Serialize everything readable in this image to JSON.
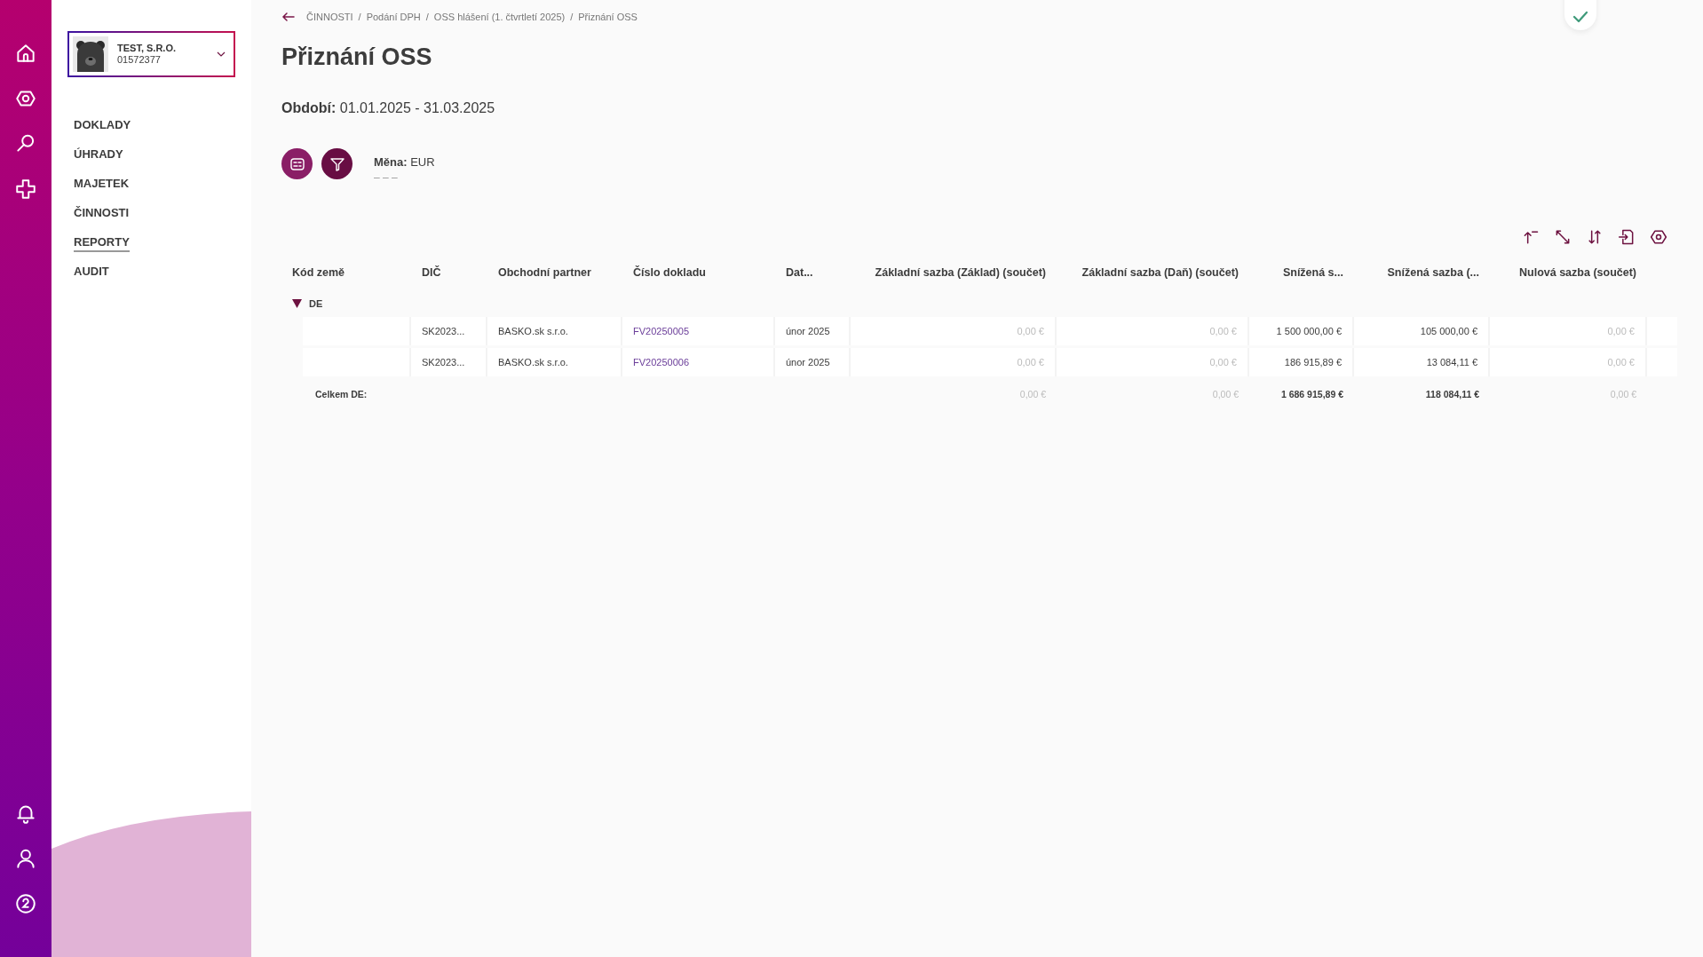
{
  "company": {
    "name": "TEST, S.R.O.",
    "id": "01572377"
  },
  "nav": [
    {
      "label": "DOKLADY",
      "selected": false
    },
    {
      "label": "ÚHRADY",
      "selected": false
    },
    {
      "label": "MAJETEK",
      "selected": false
    },
    {
      "label": "ČINNOSTI",
      "selected": false
    },
    {
      "label": "REPORTY",
      "selected": true
    },
    {
      "label": "AUDIT",
      "selected": false
    }
  ],
  "breadcrumb": {
    "separator": "/",
    "items": [
      "ČINNOSTI",
      "Podání DPH",
      "OSS hlášení (1. čtvrtletí 2025)",
      "Přiznání OSS"
    ]
  },
  "title": "Přiznání OSS",
  "period": "**Období:** 01.01.2025 - 31.03.2025",
  "currency": "**Měna:** EUR",
  "currency_hint": "– – –",
  "table": {
    "columns": [
      "Kód země",
      "DIČ",
      "Obchodní partner",
      "Číslo dokladu",
      "Dat...",
      "Základní sazba (Základ) (součet)",
      "Základní sazba (Daň) (součet)",
      "Snížená s...",
      "Snížená sazba (...",
      "Nulová sazba (součet)"
    ],
    "groups": [
      {
        "label": "DE",
        "expanded": true,
        "rows": [
          {
            "dic": "SK2023...",
            "partner": "BASKO.sk s.r.o.",
            "document": "FV20250005",
            "date": "únor 2025",
            "amounts": [
              {
                "value": "0,00 €",
                "dimmed": true
              },
              {
                "value": "0,00 €",
                "dimmed": true
              },
              {
                "value": "1 500 000,00 €",
                "dimmed": false
              },
              {
                "value": "105 000,00 €",
                "dimmed": false
              },
              {
                "value": "0,00 €",
                "dimmed": true
              }
            ]
          },
          {
            "dic": "SK2023...",
            "partner": "BASKO.sk s.r.o.",
            "document": "FV20250006",
            "date": "únor 2025",
            "amounts": [
              {
                "value": "0,00 €",
                "dimmed": true
              },
              {
                "value": "0,00 €",
                "dimmed": true
              },
              {
                "value": "186 915,89 €",
                "dimmed": false
              },
              {
                "value": "13 084,11 €",
                "dimmed": false
              },
              {
                "value": "0,00 €",
                "dimmed": true
              }
            ]
          }
        ],
        "total_label": "Celkem DE:",
        "totals": [
          {
            "value": "0,00 €",
            "dimmed": true
          },
          {
            "value": "0,00 €",
            "dimmed": true
          },
          {
            "value": "1 686 915,89 €",
            "dimmed": false
          },
          {
            "value": "118 084,11 €",
            "dimmed": false
          },
          {
            "value": "0,00 €",
            "dimmed": true
          }
        ]
      }
    ]
  }
}
